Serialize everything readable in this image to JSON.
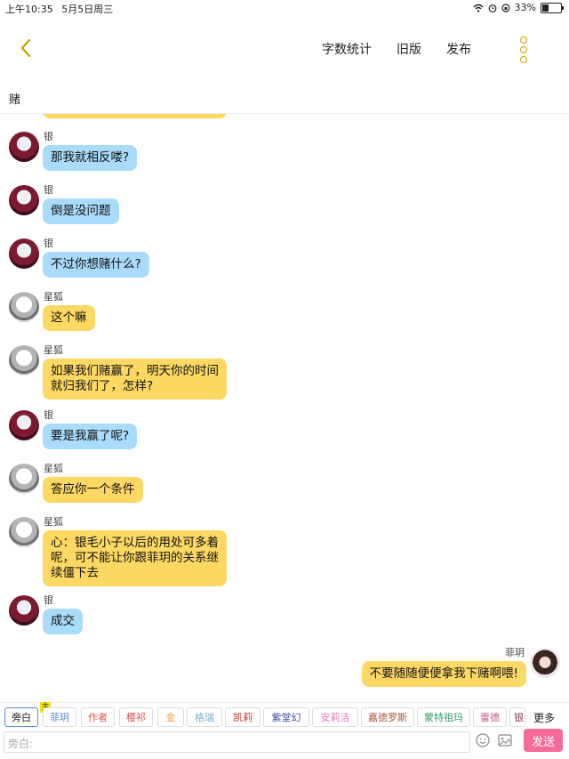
{
  "status_bar": {
    "time": "上午10:35",
    "date": "5月5日周三",
    "battery": "33%",
    "battery_level": 0.33
  },
  "nav": {
    "word_count": "字数统计",
    "old_version": "旧版",
    "publish": "发布"
  },
  "chapter_title": "赌",
  "messages": [
    {
      "speaker": "银",
      "text": "那我就相反喽?",
      "color": "blue"
    },
    {
      "speaker": "银",
      "text": "倒是没问题",
      "color": "blue"
    },
    {
      "speaker": "银",
      "text": "不过你想赌什么?",
      "color": "blue"
    },
    {
      "speaker": "星狐",
      "text": "这个嘛",
      "color": "yellow"
    },
    {
      "speaker": "星狐",
      "text": "如果我们赌赢了，明天你的时间就归我们了，怎样?",
      "color": "yellow"
    },
    {
      "speaker": "银",
      "text": "要是我赢了呢?",
      "color": "blue"
    },
    {
      "speaker": "星狐",
      "text": "答应你一个条件",
      "color": "yellow"
    },
    {
      "speaker": "星狐",
      "text": "心：银毛小子以后的用处可多着呢，可不能让你跟菲玥的关系继续僵下去",
      "color": "yellow"
    },
    {
      "speaker": "银",
      "text": "成交",
      "color": "blue"
    },
    {
      "speaker": "菲玥",
      "text": "不要随随便便拿我下赌啊喂!",
      "color": "yellow"
    }
  ],
  "characters": [
    {
      "label": "旁白",
      "color": "#222222",
      "selected": true
    },
    {
      "label": "菲玥",
      "color": "#5a8cd6",
      "badge": "主"
    },
    {
      "label": "作者",
      "color": "#d9534f"
    },
    {
      "label": "樱祁",
      "color": "#d9534f"
    },
    {
      "label": "金",
      "color": "#e8a24a"
    },
    {
      "label": "格瑞",
      "color": "#7ab0c8"
    },
    {
      "label": "凯莉",
      "color": "#c0392b"
    },
    {
      "label": "紫堂幻",
      "color": "#3b4aa0"
    },
    {
      "label": "安莉洁",
      "color": "#e07ac0"
    },
    {
      "label": "嘉德罗斯",
      "color": "#a05a3a"
    },
    {
      "label": "蒙特祖玛",
      "color": "#3aa06a"
    },
    {
      "label": "雷德",
      "color": "#c05a8a"
    },
    {
      "label": "银",
      "color": "#8a3a5a"
    }
  ],
  "more_label": "更多",
  "input": {
    "placeholder": "旁白:"
  },
  "send_label": "发送",
  "colors": {
    "blue_bubble": "#a9dcfa",
    "yellow_bubble": "#fdd964",
    "accent": "#c8a000",
    "send": "#f46a9b"
  }
}
